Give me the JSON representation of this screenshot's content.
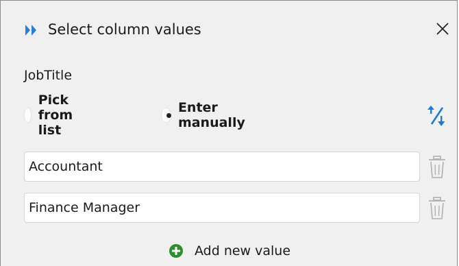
{
  "dialog": {
    "title": "Select column values",
    "icon": "double-chevron-icon",
    "close_icon": "close-icon"
  },
  "field": {
    "label": "JobTitle"
  },
  "mode": {
    "options": [
      {
        "label": "Pick from list",
        "selected": false
      },
      {
        "label": "Enter manually",
        "selected": true
      }
    ],
    "sort_icon": "sort-az-icon"
  },
  "values": {
    "items": [
      {
        "value": "Accountant",
        "delete_icon": "trash-icon"
      },
      {
        "value": "Finance Manager",
        "delete_icon": "trash-icon"
      }
    ],
    "add_label": "Add new value",
    "add_icon": "plus-circle-icon"
  },
  "colors": {
    "accent_blue": "#1e7ad4",
    "add_green": "#2e8b2e",
    "background": "#f0f0f0"
  }
}
